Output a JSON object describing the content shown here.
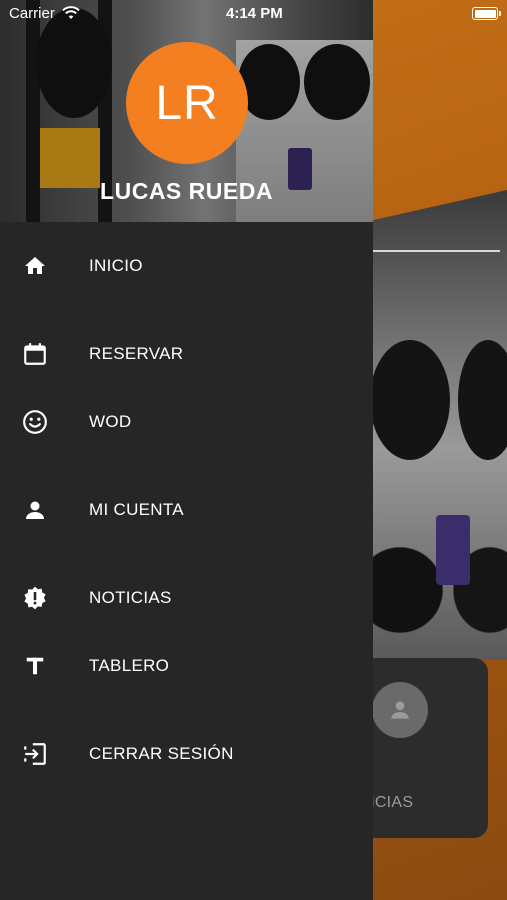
{
  "status_bar": {
    "carrier": "Carrier",
    "time": "4:14 PM",
    "icons": [
      "wifi-icon",
      "battery-icon"
    ]
  },
  "background": {
    "card_label": "ENCIAS"
  },
  "profile": {
    "initials": "LR",
    "name": "LUCAS RUEDA",
    "avatar_color": "#f47f21"
  },
  "menu": {
    "items": [
      {
        "label": "INICIO",
        "icon": "home-icon"
      },
      {
        "label": "RESERVAR",
        "icon": "calendar-icon"
      },
      {
        "label": "WOD",
        "icon": "smiley-icon"
      },
      {
        "label": "MI CUENTA",
        "icon": "person-icon"
      },
      {
        "label": "NOTICIAS",
        "icon": "alert-badge-icon"
      },
      {
        "label": "TABLERO",
        "icon": "text-t-icon"
      },
      {
        "label": "CERRAR SESIÓN",
        "icon": "logout-icon"
      }
    ]
  },
  "colors": {
    "accent": "#f47f21",
    "drawer_bg": "#262626",
    "app_bg": "#c8731a"
  }
}
